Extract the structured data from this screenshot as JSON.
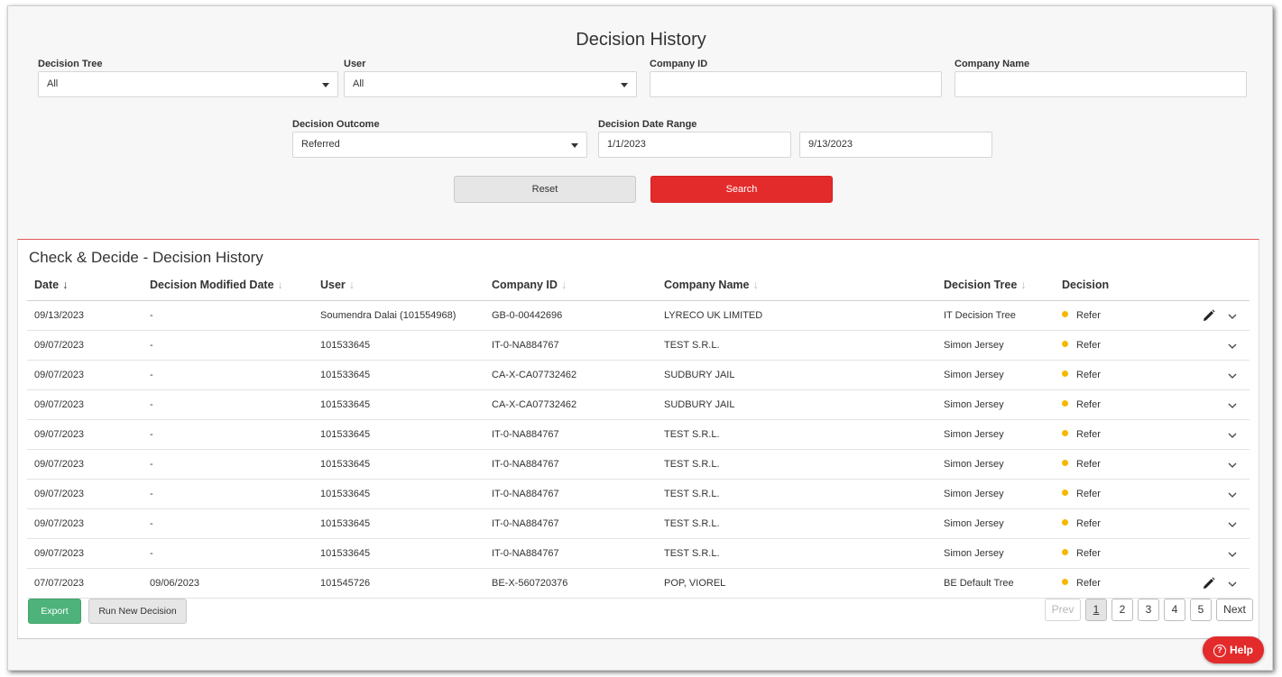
{
  "page": {
    "title": "Decision History"
  },
  "filters": {
    "decision_tree": {
      "label": "Decision Tree",
      "value": "All"
    },
    "user": {
      "label": "User",
      "value": "All"
    },
    "company_id": {
      "label": "Company ID",
      "value": ""
    },
    "company_name": {
      "label": "Company Name",
      "value": ""
    },
    "decision_outcome": {
      "label": "Decision Outcome",
      "value": "Referred"
    },
    "date_range": {
      "label": "Decision Date Range",
      "from": "1/1/2023",
      "to": "9/13/2023"
    },
    "reset_label": "Reset",
    "search_label": "Search"
  },
  "results": {
    "title": "Check & Decide - Decision History",
    "columns": {
      "date": "Date",
      "modified": "Decision Modified Date",
      "user": "User",
      "company_id": "Company ID",
      "company_name": "Company Name",
      "tree": "Decision Tree",
      "decision": "Decision"
    },
    "sort_arrow": "↓",
    "rows": [
      {
        "date": "09/13/2023",
        "modified": "-",
        "user": "Soumendra Dalai (101554968)",
        "company_id": "GB-0-00442696",
        "company_name": "LYRECO UK LIMITED",
        "tree": "IT Decision Tree",
        "decision": "Refer",
        "editable": true
      },
      {
        "date": "09/07/2023",
        "modified": "-",
        "user": "101533645",
        "company_id": "IT-0-NA884767",
        "company_name": "TEST S.R.L.",
        "tree": "Simon Jersey",
        "decision": "Refer",
        "editable": false
      },
      {
        "date": "09/07/2023",
        "modified": "-",
        "user": "101533645",
        "company_id": "CA-X-CA07732462",
        "company_name": "SUDBURY JAIL",
        "tree": "Simon Jersey",
        "decision": "Refer",
        "editable": false
      },
      {
        "date": "09/07/2023",
        "modified": "-",
        "user": "101533645",
        "company_id": "CA-X-CA07732462",
        "company_name": "SUDBURY JAIL",
        "tree": "Simon Jersey",
        "decision": "Refer",
        "editable": false
      },
      {
        "date": "09/07/2023",
        "modified": "-",
        "user": "101533645",
        "company_id": "IT-0-NA884767",
        "company_name": "TEST S.R.L.",
        "tree": "Simon Jersey",
        "decision": "Refer",
        "editable": false
      },
      {
        "date": "09/07/2023",
        "modified": "-",
        "user": "101533645",
        "company_id": "IT-0-NA884767",
        "company_name": "TEST S.R.L.",
        "tree": "Simon Jersey",
        "decision": "Refer",
        "editable": false
      },
      {
        "date": "09/07/2023",
        "modified": "-",
        "user": "101533645",
        "company_id": "IT-0-NA884767",
        "company_name": "TEST S.R.L.",
        "tree": "Simon Jersey",
        "decision": "Refer",
        "editable": false
      },
      {
        "date": "09/07/2023",
        "modified": "-",
        "user": "101533645",
        "company_id": "IT-0-NA884767",
        "company_name": "TEST S.R.L.",
        "tree": "Simon Jersey",
        "decision": "Refer",
        "editable": false
      },
      {
        "date": "09/07/2023",
        "modified": "-",
        "user": "101533645",
        "company_id": "IT-0-NA884767",
        "company_name": "TEST S.R.L.",
        "tree": "Simon Jersey",
        "decision": "Refer",
        "editable": false
      },
      {
        "date": "07/07/2023",
        "modified": "09/06/2023",
        "user": "101545726",
        "company_id": "BE-X-560720376",
        "company_name": "POP, VIOREL",
        "tree": "BE Default Tree",
        "decision": "Refer",
        "editable": true
      }
    ],
    "export_label": "Export",
    "run_new_label": "Run New Decision"
  },
  "pagination": {
    "prev": "Prev",
    "pages": [
      "1",
      "2",
      "3",
      "4",
      "5"
    ],
    "current": "1",
    "next": "Next"
  },
  "help": {
    "label": "Help",
    "icon": "?"
  },
  "colors": {
    "accent_red": "#e32b2b",
    "export_green": "#4db37a",
    "refer_dot": "#f5b800"
  }
}
